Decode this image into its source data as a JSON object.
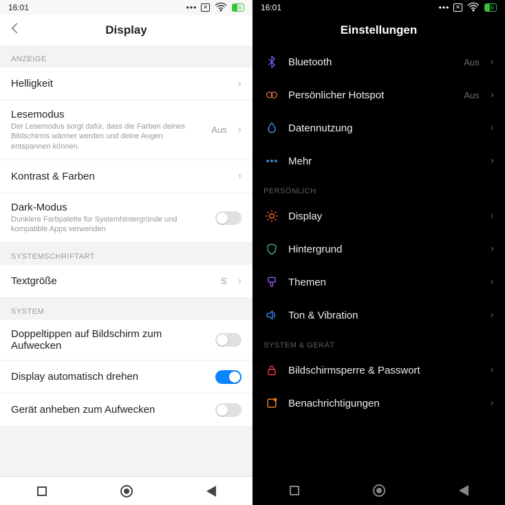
{
  "status": {
    "time": "16:01",
    "battery": "46"
  },
  "left": {
    "title": "Display",
    "sections": {
      "anzeige": {
        "label": "ANZEIGE",
        "items": {
          "brightness": {
            "label": "Helligkeit"
          },
          "reading": {
            "label": "Lesemodus",
            "sub": "Der Lesemodus sorgt dafür, dass die Farben deines Bildschirms wärmer werden und deine Augen entspannen können.",
            "value": "Aus"
          },
          "contrast": {
            "label": "Kontrast & Farben"
          },
          "darkmode": {
            "label": "Dark-Modus",
            "sub": "Dunklere Farbpalette für Systemhintergründe und kompatible Apps verwenden",
            "toggle": false
          }
        }
      },
      "font": {
        "label": "SYSTEMSCHRIFTART",
        "items": {
          "textsize": {
            "label": "Textgröße",
            "value": "S"
          }
        }
      },
      "system": {
        "label": "SYSTEM",
        "items": {
          "doubletap": {
            "label": "Doppeltippen auf Bildschirm zum Aufwecken",
            "toggle": false
          },
          "autorotate": {
            "label": "Display automatisch drehen",
            "toggle": true
          },
          "raise": {
            "label": "Gerät anheben zum Aufwecken",
            "toggle": false
          }
        }
      }
    }
  },
  "right": {
    "title": "Einstellungen",
    "sections": {
      "conn": {
        "items": {
          "bluetooth": {
            "label": "Bluetooth",
            "value": "Aus",
            "icon": "bluetooth-icon",
            "color": "#7b5cff"
          },
          "hotspot": {
            "label": "Persönlicher Hotspot",
            "value": "Aus",
            "icon": "hotspot-icon",
            "color": "#d96b3a"
          },
          "datausage": {
            "label": "Datennutzung",
            "icon": "drop-icon",
            "color": "#4aa0ff"
          },
          "more": {
            "label": "Mehr",
            "icon": "dots-icon",
            "color": "#4aa0ff"
          }
        }
      },
      "personal": {
        "label": "PERSÖNLICH",
        "items": {
          "display": {
            "label": "Display",
            "icon": "sun-icon",
            "color": "#ff6a2b"
          },
          "wallpaper": {
            "label": "Hintergrund",
            "icon": "shield-icon",
            "color": "#3fb98f"
          },
          "themes": {
            "label": "Themen",
            "icon": "brush-icon",
            "color": "#9a5cff"
          },
          "sound": {
            "label": "Ton & Vibration",
            "icon": "volume-icon",
            "color": "#2e91ff"
          }
        }
      },
      "sysdev": {
        "label": "SYSTEM & GERÄT",
        "items": {
          "lockscreen": {
            "label": "Bildschirmsperre & Passwort",
            "icon": "lock-icon",
            "color": "#ff3b5b"
          },
          "notif": {
            "label": "Benachrichtigungen",
            "icon": "bell-icon",
            "color": "#ff8a2b"
          }
        }
      }
    }
  }
}
